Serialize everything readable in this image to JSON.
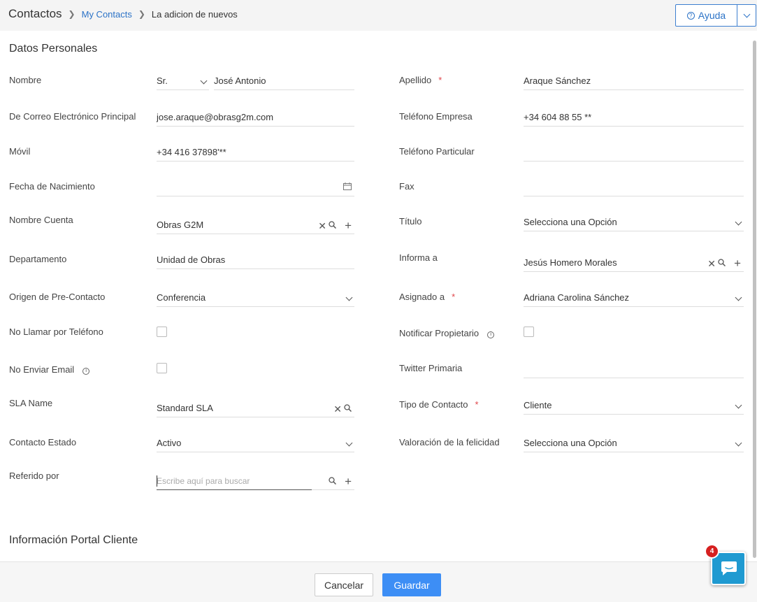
{
  "header": {
    "root": "Contactos",
    "link": "My Contacts",
    "current": "La adicion de nuevos",
    "help_label": "Ayuda"
  },
  "sections": {
    "personal": "Datos Personales",
    "portal": "Información Portal Cliente"
  },
  "labels": {
    "nombre": "Nombre",
    "apellido": "Apellido",
    "email": "De Correo Electrónico Principal",
    "tel_empresa": "Teléfono Empresa",
    "movil": "Móvil",
    "tel_particular": "Teléfono Particular",
    "fecha_nacimiento": "Fecha de Nacimiento",
    "fax": "Fax",
    "nombre_cuenta": "Nombre Cuenta",
    "titulo": "Título",
    "departamento": "Departamento",
    "informa_a": "Informa a",
    "origen": "Origen de Pre-Contacto",
    "asignado": "Asignado a",
    "no_llamar": "No Llamar por Teléfono",
    "notificar": "Notificar Propietario",
    "no_email": "No Enviar Email",
    "twitter": "Twitter Primaria",
    "sla": "SLA Name",
    "tipo_contacto": "Tipo de Contacto",
    "estado": "Contacto Estado",
    "felicidad": "Valoración de la felicidad",
    "referido": "Referido por"
  },
  "values": {
    "saludo": "Sr.",
    "nombre": "José Antonio",
    "apellido": "Araque Sánchez",
    "email": "jose.araque@obrasg2m.com",
    "tel_empresa": "+34 604 88 55 **",
    "movil": "+34 416 37898'**",
    "tel_particular": "",
    "fecha_nacimiento": "",
    "fax": "",
    "nombre_cuenta": "Obras G2M",
    "titulo": "Selecciona una Opción",
    "departamento": "Unidad de Obras",
    "informa_a": "Jesús Homero Morales",
    "origen": "Conferencia",
    "asignado": "Adriana Carolina Sánchez",
    "twitter": "",
    "sla": "Standard SLA",
    "tipo_contacto": "Cliente",
    "estado": "Activo",
    "felicidad": "Selecciona una Opción"
  },
  "placeholders": {
    "referido": "Escribe aquí para buscar"
  },
  "footer": {
    "cancel": "Cancelar",
    "save": "Guardar"
  },
  "chat": {
    "badge": "4"
  },
  "colors": {
    "accent": "#3d8ef5",
    "link": "#2c73c7",
    "required": "#e0464b",
    "badge": "#d62020"
  }
}
